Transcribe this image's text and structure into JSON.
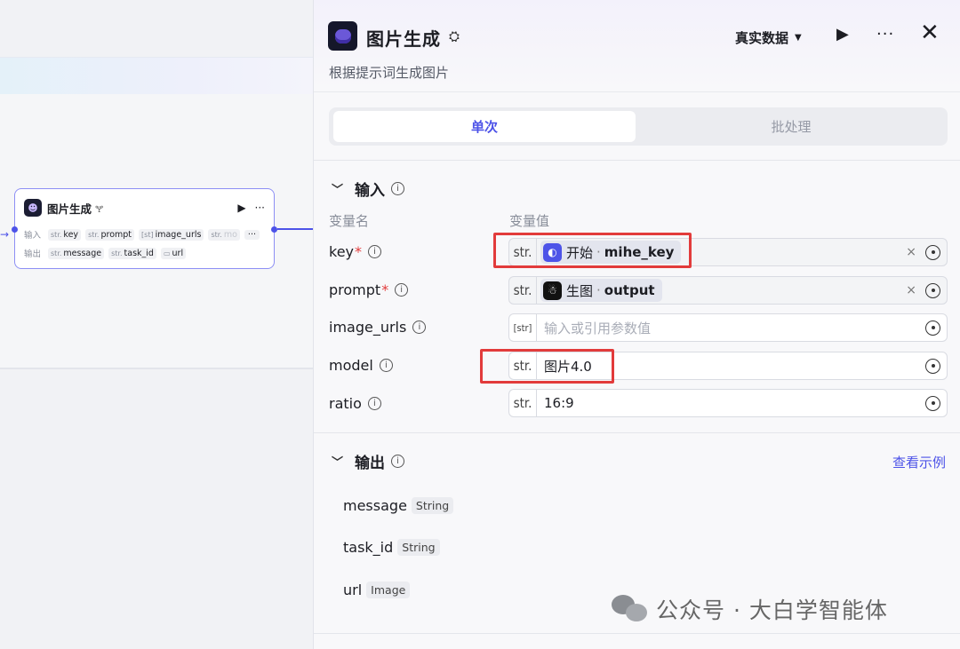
{
  "canvas": {
    "node": {
      "title": "图片生成",
      "title_icon": "🝖",
      "run_glyph": "▶",
      "more_glyph": "···",
      "input_label": "输入",
      "output_label": "输出",
      "inputs": [
        {
          "type": "str.",
          "name": "key"
        },
        {
          "type": "str.",
          "name": "prompt"
        },
        {
          "type": "[st]",
          "name": "image_urls"
        },
        {
          "type": "str.",
          "name": "mo"
        }
      ],
      "inputs_more": "···",
      "outputs": [
        {
          "type": "str.",
          "name": "message"
        },
        {
          "type": "str.",
          "name": "task_id"
        },
        {
          "type": "▭",
          "name": "url"
        }
      ]
    }
  },
  "panel": {
    "title": "图片生成",
    "description": "根据提示词生成图片",
    "data_mode": "真实数据",
    "tabs": {
      "single": "单次",
      "batch": "批处理"
    },
    "input_section": {
      "title": "输入",
      "col_name": "变量名",
      "col_value": "变量值",
      "rows": [
        {
          "name": "key",
          "required": "*",
          "type": "str.",
          "ref_node": "开始",
          "ref_sep": "·",
          "ref_var": "mihe_key",
          "clear": "×"
        },
        {
          "name": "prompt",
          "required": "*",
          "type": "str.",
          "ref_node": "生图",
          "ref_sep": "·",
          "ref_var": "output",
          "clear": "×"
        },
        {
          "name": "image_urls",
          "type": "[str]",
          "placeholder": "输入或引用参数值"
        },
        {
          "name": "model",
          "type": "str.",
          "value": "图片4.0"
        },
        {
          "name": "ratio",
          "type": "str.",
          "value": "16:9"
        }
      ]
    },
    "output_section": {
      "title": "输出",
      "view_example": "查看示例",
      "rows": [
        {
          "name": "message",
          "type": "String"
        },
        {
          "name": "task_id",
          "type": "String"
        },
        {
          "name": "url",
          "type": "Image"
        }
      ]
    }
  },
  "watermark": {
    "text": "公众号 · 大白学智能体"
  },
  "colors": {
    "accent": "#4d53e8",
    "highlight": "#e23b3b",
    "required": "#e23b3b"
  }
}
